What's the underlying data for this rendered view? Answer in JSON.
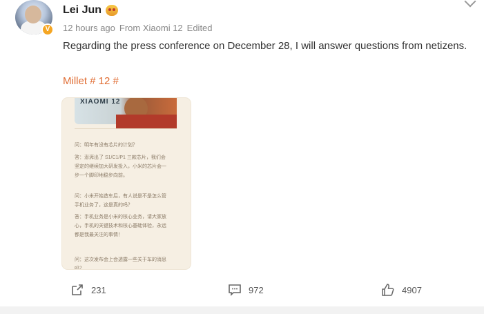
{
  "post": {
    "author": "Lei Jun",
    "time": "12 hours ago",
    "source": "From Xiaomi 12",
    "edited": "Edited",
    "text": "Regarding the press conference on December 28, I will answer questions from netizens.",
    "topic": "Millet # 12 #",
    "image": {
      "brand": "XIAOMI 12",
      "qa_blocks": [
        "问：明年有没有芯片的计划？",
        "答：澎湃出了 S1/C1/P1 三款芯片，我们会\n坚定的继续加大研发投入，小米的芯片会一\n步一个脚印地稳步向前。",
        "问：小米开始造车后，有人说是不是怎么管\n手机业务了，这是真的吗？",
        "答：手机业务是小米的核心业务，请大家放\n心，手机的关键技术和核心基础体验，永远\n都是我最关注的事情！",
        "问：这次发布会上会透露一些关于车的消息\n吗？"
      ]
    }
  },
  "actions": {
    "repost_count": "231",
    "comment_count": "972",
    "like_count": "4907"
  }
}
